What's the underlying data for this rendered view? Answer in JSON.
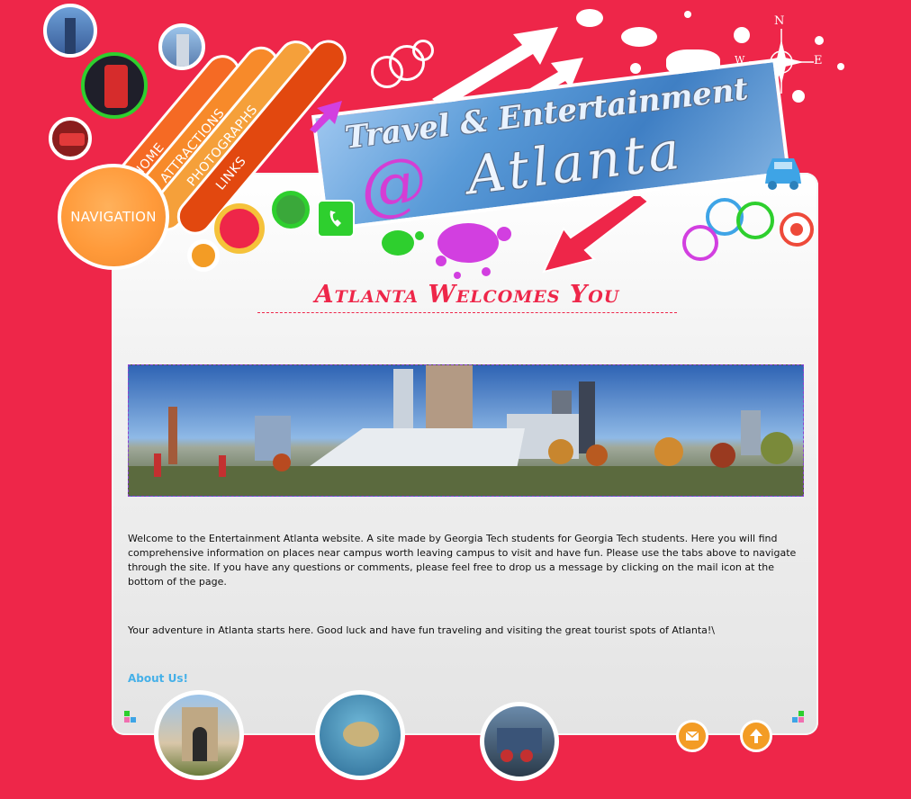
{
  "colors": {
    "background": "#ee2649",
    "accent_orange": "#f39c25",
    "link_blue": "#45b0e8",
    "title_red": "#ee2649"
  },
  "banner": {
    "line1": "Travel & Entertainment",
    "at": "@",
    "line2": "Atlanta"
  },
  "compass": {
    "n": "N",
    "w": "W",
    "e": "E"
  },
  "nav": {
    "circle_label": "NAVIGATION",
    "items": [
      {
        "label": "HOME"
      },
      {
        "label": "ATTRACTIONS"
      },
      {
        "label": "PHOTOGRAPHS"
      },
      {
        "label": "LINKS"
      }
    ]
  },
  "main": {
    "title": "Atlanta Welcomes You",
    "intro": "Welcome to the Entertainment Atlanta website. A site made by Georgia Tech students for Georgia Tech students. Here you will find comprehensive information on places near campus worth leaving campus to visit and have fun. Please use the tabs above to navigate through the site. If you have any questions or comments, please feel free to drop us a message by clicking on the mail icon at the bottom of the page.",
    "tagline": "Your adventure in Atlanta starts here. Good luck and have fun traveling and visiting the great tourist spots of Atlanta!\\",
    "about_link": "About Us!"
  },
  "icons": {
    "mail": "mail-icon",
    "top": "arrow-up-icon",
    "phone": "phone-icon",
    "car": "car-icon"
  }
}
